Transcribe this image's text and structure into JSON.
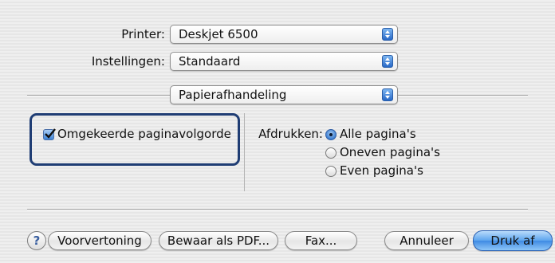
{
  "printer": {
    "label": "Printer:",
    "value": "Deskjet 6500"
  },
  "presets": {
    "label": "Instellingen:",
    "value": "Standaard"
  },
  "pane_selector": {
    "value": "Papierafhandeling"
  },
  "reverse_order": {
    "label": "Omgekeerde paginavolgorde",
    "checked": true
  },
  "print_pages": {
    "label": "Afdrukken:",
    "options": [
      {
        "label": "Alle pagina's",
        "selected": true
      },
      {
        "label": "Oneven pagina's",
        "selected": false
      },
      {
        "label": "Even pagina's",
        "selected": false
      }
    ]
  },
  "buttons": {
    "help": "?",
    "preview": "Voorvertoning",
    "save_pdf": "Bewaar als PDF...",
    "fax": "Fax...",
    "cancel": "Annuleer",
    "print": "Druk af"
  },
  "colors": {
    "highlight_border": "#1f3d74",
    "default_button": "#5ba4ee",
    "accent": "#3579cf"
  }
}
